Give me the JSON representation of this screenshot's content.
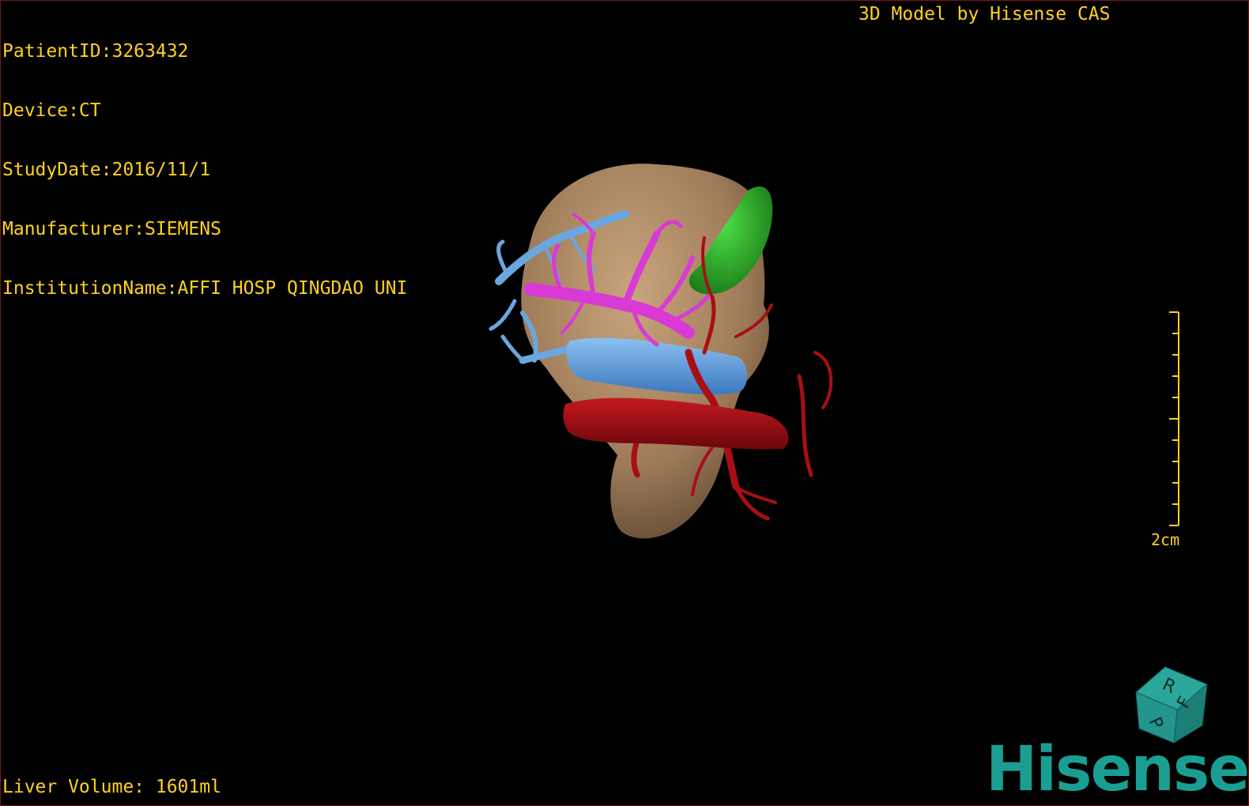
{
  "overlay": {
    "patient_id": "PatientID:3263432",
    "device": "Device:CT",
    "study_date": "StudyDate:2016/11/1",
    "manufacturer": "Manufacturer:SIEMENS",
    "institution": "InstitutionName:AFFI HOSP QINGDAO UNI",
    "credit": "3D Model by Hisense CAS",
    "liver_volume": "Liver Volume: 1601ml"
  },
  "scale": {
    "label": "2cm"
  },
  "orientation_cube": {
    "faces": [
      "R",
      "F",
      "P"
    ]
  },
  "logo": {
    "text": "Hisense"
  },
  "colors": {
    "overlay_text": "#ffd21f",
    "liver": "#b08c68",
    "portal_vein": "#d93ad6",
    "hepatic_vein": "#6aa6e0",
    "artery": "#a80f14",
    "gallbladder": "#2fb52a",
    "brand": "#1a9e92"
  },
  "icons": [
    "orientation-cube-icon",
    "scale-bar-icon"
  ]
}
